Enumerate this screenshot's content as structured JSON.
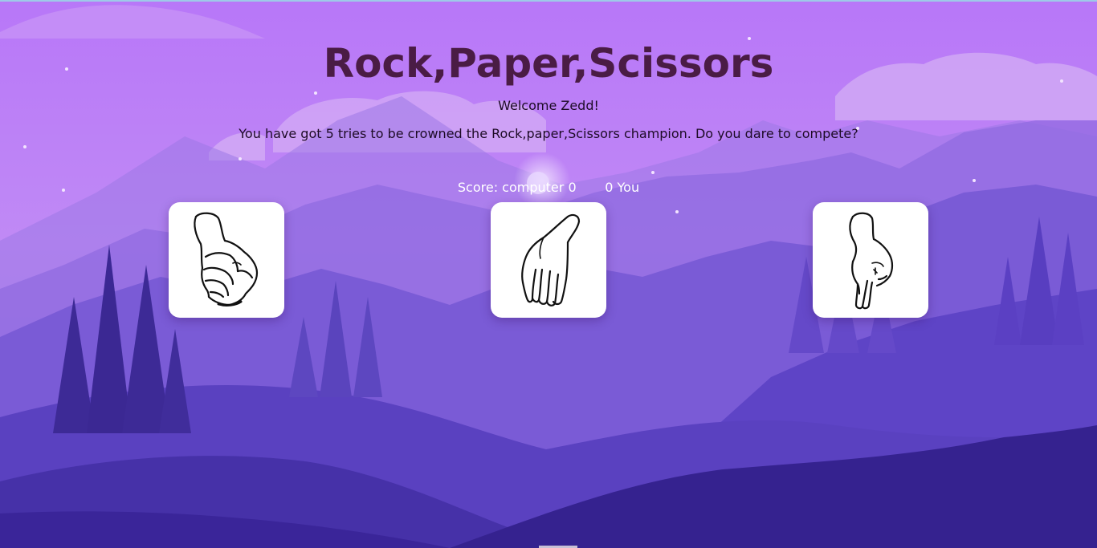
{
  "header": {
    "title": "Rock,Paper,Scissors",
    "welcome": "Welcome Zedd!",
    "intro": "You have got 5 tries to be crowned the Rock,paper,Scissors champion. Do you dare to compete?"
  },
  "score": {
    "prefix": "Score: computer",
    "computer": "0",
    "you": "0",
    "you_label": "You"
  },
  "choices": [
    {
      "id": "rock",
      "icon": "fist-hand-icon"
    },
    {
      "id": "paper",
      "icon": "open-hand-icon"
    },
    {
      "id": "scissors",
      "icon": "pointing-fingers-hand-icon"
    }
  ],
  "colors": {
    "sky_top": "#b97cf7",
    "sky_bottom": "#a886ec",
    "title": "#4a1c45",
    "card": "#ffffff",
    "foreground": "#2d1a78"
  }
}
